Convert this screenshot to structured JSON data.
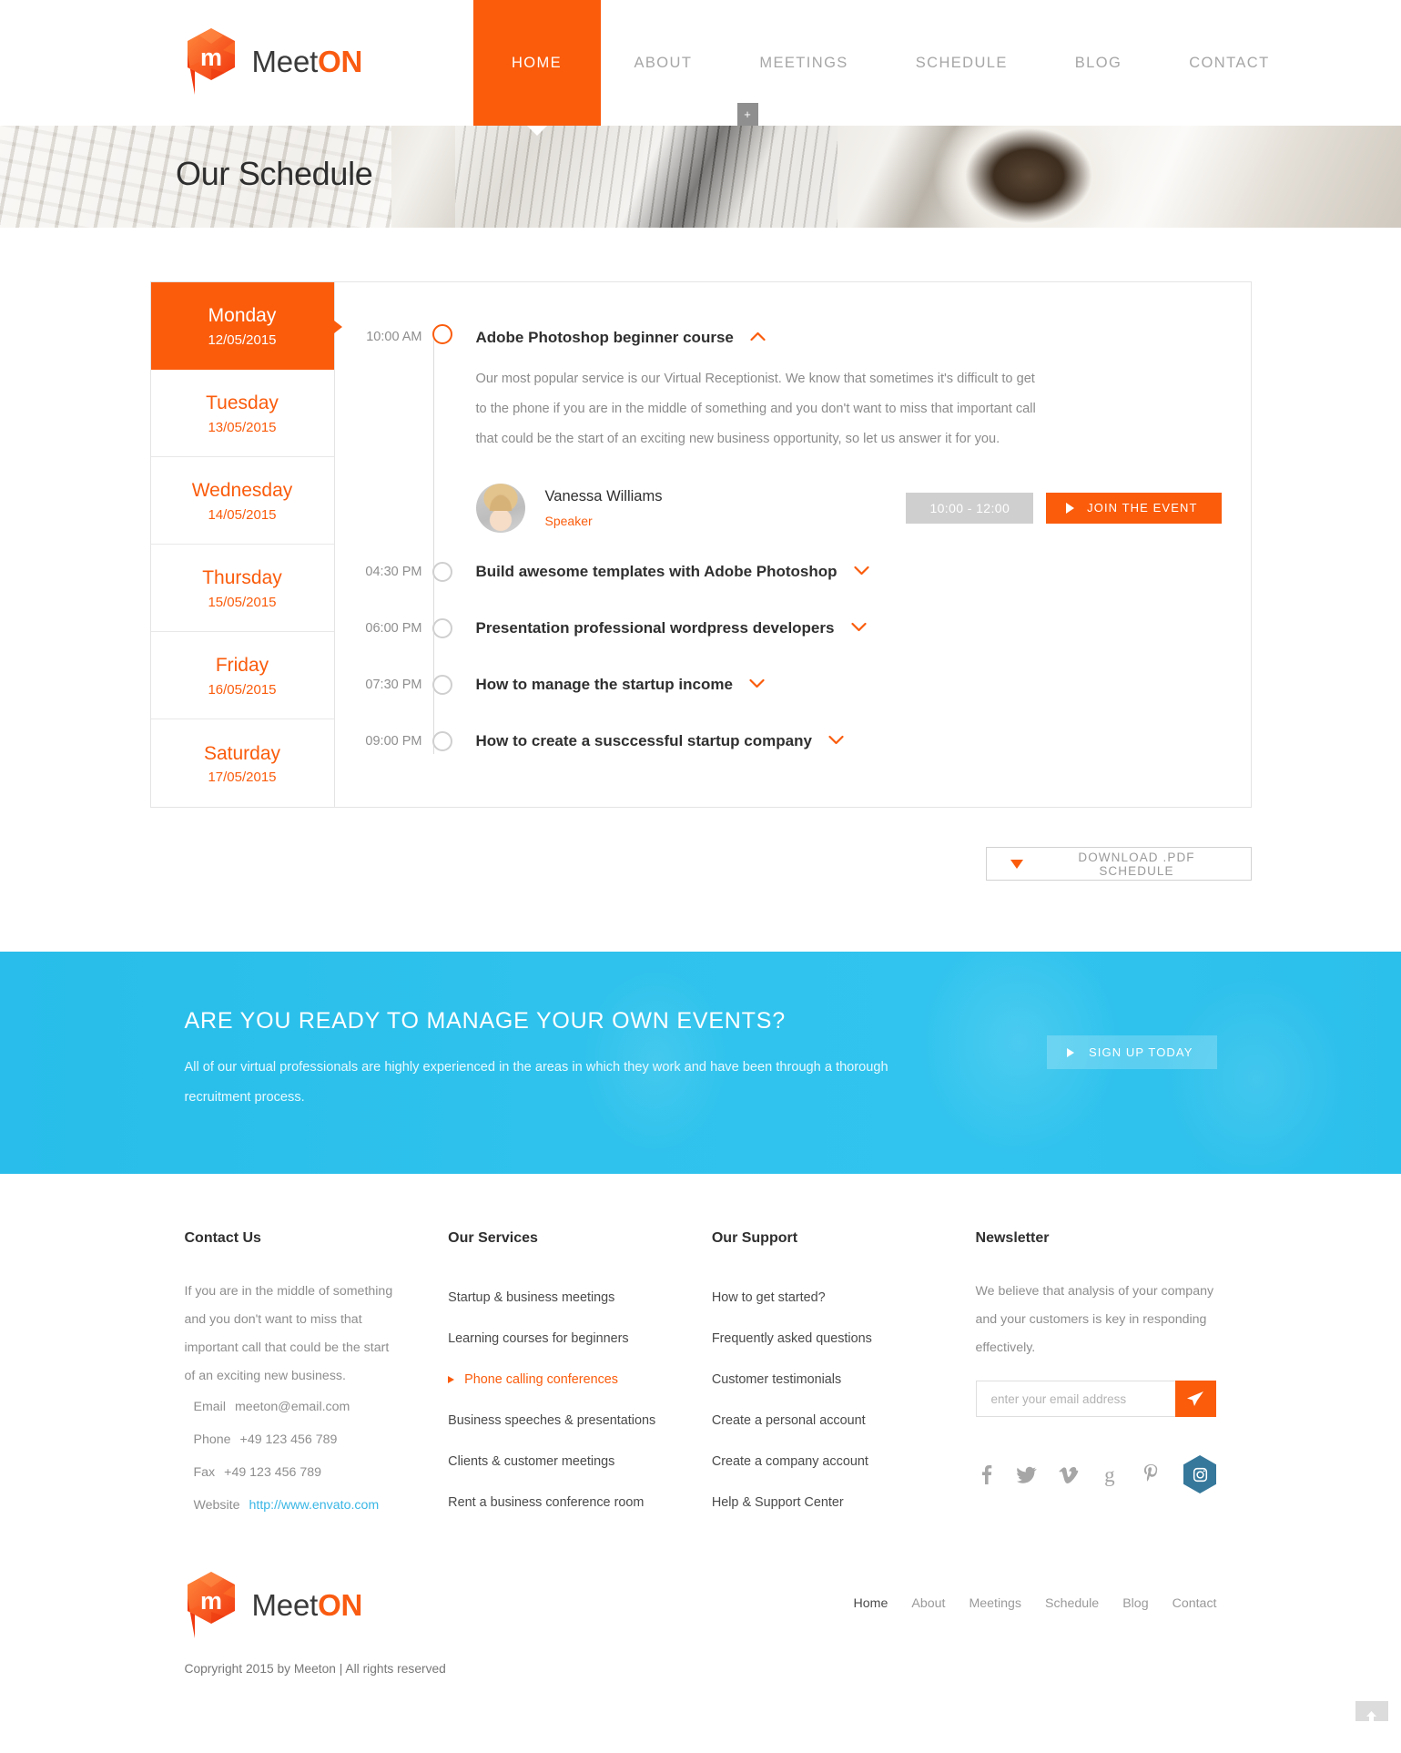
{
  "brand": {
    "name_light": "Meet",
    "name_bold": "ON",
    "logo_icon": "meeton-hex-logo-icon"
  },
  "nav": {
    "items": [
      {
        "label": "HOME",
        "active": true
      },
      {
        "label": "ABOUT",
        "active": false
      },
      {
        "label": "MEETINGS",
        "active": false
      },
      {
        "label": "SCHEDULE",
        "active": false
      },
      {
        "label": "BLOG",
        "active": false
      },
      {
        "label": "CONTACT",
        "active": false
      }
    ],
    "plus_label": "+"
  },
  "hero": {
    "title": "Our Schedule"
  },
  "schedule": {
    "days": [
      {
        "name": "Monday",
        "date": "12/05/2015",
        "active": true
      },
      {
        "name": "Tuesday",
        "date": "13/05/2015",
        "active": false
      },
      {
        "name": "Wednesday",
        "date": "14/05/2015",
        "active": false
      },
      {
        "name": "Thursday",
        "date": "15/05/2015",
        "active": false
      },
      {
        "name": "Friday",
        "date": "16/05/2015",
        "active": false
      },
      {
        "name": "Saturday",
        "date": "17/05/2015",
        "active": false
      }
    ],
    "events": [
      {
        "time": "10:00 AM",
        "title": "Adobe Photoshop beginner course",
        "expanded": true,
        "description": "Our most popular service is our Virtual Receptionist. We know that sometimes it's difficult to get to the phone if you are in the middle of something and you don't want to miss that important call that could be the start of an exciting new business opportunity, so let us answer it for you.",
        "speaker_name": "Vanessa Williams",
        "speaker_role": "Speaker",
        "time_badge": "10:00 - 12:00",
        "join_label": "JOIN THE EVENT"
      },
      {
        "time": "04:30 PM",
        "title": "Build awesome templates with Adobe Photoshop",
        "expanded": false
      },
      {
        "time": "06:00 PM",
        "title": "Presentation professional wordpress developers",
        "expanded": false
      },
      {
        "time": "07:30 PM",
        "title": "How to manage the startup income",
        "expanded": false
      },
      {
        "time": "09:00 PM",
        "title": "How to create a susccessful startup company",
        "expanded": false
      }
    ],
    "download_label": "DOWNLOAD .PDF SCHEDULE"
  },
  "cta": {
    "title": "ARE YOU READY TO MANAGE YOUR OWN EVENTS?",
    "text": "All of our virtual professionals are highly experienced in the areas in which they work and have been through a thorough recruitment process.",
    "button_label": "SIGN UP TODAY"
  },
  "footer": {
    "contact": {
      "heading": "Contact Us",
      "text": "If you are in the middle of something and you don't want to miss that important call that could be the start of an exciting new business.",
      "email_label": "Email",
      "email_value": "meeton@email.com",
      "phone_label": "Phone",
      "phone_value": "+49 123 456 789",
      "fax_label": "Fax",
      "fax_value": "+49 123 456 789",
      "website_label": "Website",
      "website_value": "http://www.envato.com"
    },
    "services": {
      "heading": "Our Services",
      "items": [
        {
          "label": "Startup & business meetings",
          "active": false
        },
        {
          "label": "Learning courses for beginners",
          "active": false
        },
        {
          "label": "Phone calling conferences",
          "active": true
        },
        {
          "label": "Business speeches & presentations",
          "active": false
        },
        {
          "label": "Clients & customer meetings",
          "active": false
        },
        {
          "label": "Rent a business conference room",
          "active": false
        }
      ]
    },
    "support": {
      "heading": "Our Support",
      "items": [
        {
          "label": "How to get started?",
          "active": false
        },
        {
          "label": "Frequently asked questions",
          "active": false
        },
        {
          "label": "Customer testimonials",
          "active": false
        },
        {
          "label": "Create a personal account",
          "active": false
        },
        {
          "label": "Create a company account",
          "active": false
        },
        {
          "label": "Help & Support Center",
          "active": false
        }
      ]
    },
    "newsletter": {
      "heading": "Newsletter",
      "text": "We believe that analysis of your company and your customers is key in responding effectively.",
      "placeholder": "enter your email address",
      "value": "",
      "socials": [
        "facebook-icon",
        "twitter-icon",
        "vimeo-icon",
        "google-plus-icon",
        "pinterest-icon",
        "instagram-icon"
      ]
    }
  },
  "bottom": {
    "nav": [
      {
        "label": "Home",
        "active": true
      },
      {
        "label": "About",
        "active": false
      },
      {
        "label": "Meetings",
        "active": false
      },
      {
        "label": "Schedule",
        "active": false
      },
      {
        "label": "Blog",
        "active": false
      },
      {
        "label": "Contact",
        "active": false
      }
    ],
    "copyright": "Copryright 2015 by Meeton | All rights reserved"
  },
  "colors": {
    "accent": "#fa5c0c",
    "cta_bg": "#2fc0ea",
    "link_blue": "#39b6e5",
    "instagram_hex": "#36789b"
  }
}
